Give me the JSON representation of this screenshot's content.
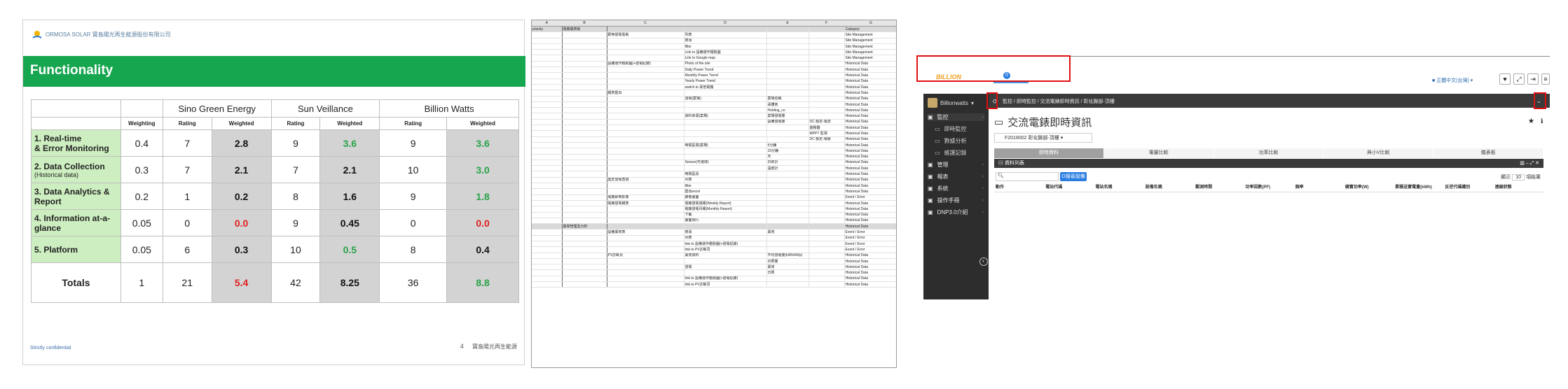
{
  "slide": {
    "logo_text": "ORMOSA SOLAR 寶島陽光再生能源股份有限公司",
    "logo_caption": "FORMOSA",
    "title": "Functionality",
    "vendors": [
      "Sino Green Energy",
      "Sun Veillance",
      "Billion Watts"
    ],
    "subheaders": {
      "weighting": "Weighting",
      "rating": "Rating",
      "weighted": "Weighted"
    },
    "rows": [
      {
        "criterion": "1. Real-time\n& Error Monitoring",
        "sub": "",
        "weight": "0.4",
        "v": [
          "7",
          "2.8",
          "9",
          "3.6",
          "9",
          "3.6"
        ]
      },
      {
        "criterion": "2. Data Collection",
        "sub": "(Historical data)",
        "weight": "0.3",
        "v": [
          "7",
          "2.1",
          "7",
          "2.1",
          "10",
          "3.0"
        ]
      },
      {
        "criterion": "3. Data Analytics & Report",
        "sub": "",
        "weight": "0.2",
        "v": [
          "1",
          "0.2",
          "8",
          "1.6",
          "9",
          "1.8"
        ]
      },
      {
        "criterion": "4. Information at-a-glance",
        "sub": "",
        "weight": "0.05",
        "v": [
          "0",
          "0.0",
          "9",
          "0.45",
          "0",
          "0.0"
        ]
      },
      {
        "criterion": "5. Platform",
        "sub": "",
        "weight": "0.05",
        "v": [
          "6",
          "0.3",
          "10",
          "0.5",
          "8",
          "0.4"
        ]
      }
    ],
    "weighted_colors": [
      [
        "black",
        "green",
        "green"
      ],
      [
        "black",
        "black",
        "green"
      ],
      [
        "black",
        "black",
        "green"
      ],
      [
        "red",
        "black",
        "red"
      ],
      [
        "black",
        "green",
        "black"
      ]
    ],
    "totals": {
      "label": "Totals",
      "weight": "1",
      "v": [
        "21",
        "5.4",
        "42",
        "8.25",
        "36",
        "8.8"
      ],
      "colors": [
        "red",
        "black",
        "green"
      ]
    },
    "footer_left": "Strictly confidential",
    "page_number": "4",
    "footer_right": "寶島陽光再生能源",
    "colors": {
      "banner": "#17a650",
      "criterion_bg": "#cdeec0",
      "weighted_bg": "#d3d3d3",
      "green": "#29a34a",
      "red": "#e02020"
    }
  },
  "sheet": {
    "col_headers": [
      "A",
      "B",
      "C",
      "D",
      "E",
      "F",
      "G"
    ],
    "rows": [
      [
        "priority",
        "電廠儀表板",
        "",
        "",
        "",
        "",
        "Category"
      ],
      [
        "",
        "",
        "即時發電看板",
        "列表",
        "",
        "",
        "Site Management"
      ],
      [
        "",
        "",
        "",
        "搜尋",
        "",
        "",
        "Site Management"
      ],
      [
        "",
        "",
        "",
        "filter",
        "",
        "",
        "Site Management"
      ],
      [
        "",
        "",
        "",
        "Link to 設備運作趨勢圖",
        "",
        "",
        "Site Management"
      ],
      [
        "",
        "",
        "",
        "Link to Google map",
        "",
        "",
        "Site Management"
      ],
      [
        "",
        "",
        "設備運作趨勢圖(+發電紀錄)",
        "Photo of the site",
        "",
        "",
        "Historical Data"
      ],
      [
        "",
        "",
        "",
        "Daily Power Trend",
        "",
        "",
        "Historical Data"
      ],
      [
        "",
        "",
        "",
        "Monthly Power Trend",
        "",
        "",
        "Historical Data"
      ],
      [
        "",
        "",
        "",
        "Yearly Power Trend",
        "",
        "",
        "Historical Data"
      ],
      [
        "",
        "",
        "",
        "switch to 其他電廠",
        "",
        "",
        "Historical Data"
      ],
      [
        "",
        "",
        "報表匯出",
        "",
        "",
        "",
        "Historical Data"
      ],
      [
        "",
        "",
        "",
        "發電(案場)",
        "案場名稱",
        "",
        "Historical Data"
      ],
      [
        "",
        "",
        "",
        "",
        "承攬商",
        "",
        "Historical Data"
      ],
      [
        "",
        "",
        "",
        "",
        "Holding_co",
        "",
        "Historical Data"
      ],
      [
        "",
        "",
        "",
        "資料來源(案場)",
        "案場發電量",
        "",
        "Historical Data"
      ],
      [
        "",
        "",
        "",
        "",
        "設備發電量",
        "DC 額定-電流",
        "Historical Data"
      ],
      [
        "",
        "",
        "",
        "",
        "",
        "變壓器",
        "Historical Data"
      ],
      [
        "",
        "",
        "",
        "",
        "",
        "MPPT 監視",
        "Historical Data"
      ],
      [
        "",
        "",
        "",
        "",
        "",
        "DC 額定-電壓",
        "Historical Data"
      ],
      [
        "",
        "",
        "",
        "時間區間(案場)",
        "5分鐘",
        "",
        "Historical Data"
      ],
      [
        "",
        "",
        "",
        "",
        "15分鐘",
        "",
        "Historical Data"
      ],
      [
        "",
        "",
        "",
        "",
        "天",
        "",
        "Historical Data"
      ],
      [
        "",
        "",
        "",
        "Sensor(可選擇)",
        "日照計",
        "",
        "Historical Data"
      ],
      [
        "",
        "",
        "",
        "",
        "溫度計",
        "",
        "Historical Data"
      ],
      [
        "",
        "",
        "",
        "時間區段",
        "",
        "",
        "Historical Data"
      ],
      [
        "",
        "",
        "歷史發電查詢",
        "列表",
        "",
        "",
        "Historical Data"
      ],
      [
        "",
        "",
        "",
        "filter",
        "",
        "",
        "Historical Data"
      ],
      [
        "",
        "",
        "",
        "匯出excel",
        "",
        "",
        "Historical Data"
      ],
      [
        "",
        "",
        "電廠即時影像",
        "錄像畫面",
        "",
        "",
        "Event / Error"
      ],
      [
        "",
        "",
        "電廠發電報表",
        "電廠發電週報(Weekly Report)",
        "",
        "",
        "Historical Data"
      ],
      [
        "",
        "",
        "",
        "電廠發電月報(Monthly Report)",
        "",
        "",
        "Historical Data"
      ],
      [
        "",
        "",
        "",
        "下載",
        "",
        "",
        "Historical Data"
      ],
      [
        "",
        "",
        "",
        "畫面預行",
        "",
        "",
        "Historical Data"
      ],
      [
        "",
        "異常管理及分析",
        "",
        "",
        "",
        "",
        "Historical Data"
      ],
      [
        "",
        "",
        "設備異常表",
        "搜尋",
        "異常",
        "",
        "Event / Error"
      ],
      [
        "",
        "",
        "",
        "列表",
        "",
        "",
        "Event / Error"
      ],
      [
        "",
        "",
        "",
        "link to 設備運作趨勢圖(+發電紀錄)",
        "",
        "",
        "Event / Error"
      ],
      [
        "",
        "",
        "",
        "link to PV診斷頁",
        "",
        "",
        "Event / Error"
      ],
      [
        "",
        "",
        "PV診斷頁",
        "異常資料",
        "平均發電量(kWh/kWp)",
        "",
        "Historical Data"
      ],
      [
        "",
        "",
        "",
        "",
        "日照量",
        "",
        "Historical Data"
      ],
      [
        "",
        "",
        "",
        "發電",
        "異常",
        "",
        "Historical Data"
      ],
      [
        "",
        "",
        "",
        "",
        "日照",
        "",
        "Historical Data"
      ],
      [
        "",
        "",
        "",
        "link to 設備運作趨勢圖(+發電紀錄)",
        "",
        "",
        "Historical Data"
      ],
      [
        "",
        "",
        "",
        "link to PV診斷頁",
        "",
        "",
        "Historical Data"
      ]
    ]
  },
  "app": {
    "brand": "BILLION",
    "tab_badge": "0",
    "language": "正體中文(台灣)",
    "username": "Billionwatts",
    "sidebar": [
      {
        "label": "監控",
        "icon": "monitor-icon",
        "level": 0,
        "selected": true
      },
      {
        "label": "即時監控",
        "icon": "screen-icon",
        "level": 1
      },
      {
        "label": "數據分析",
        "icon": "chart-icon",
        "level": 1
      },
      {
        "label": "維護記錄",
        "icon": "record-icon",
        "level": 1
      },
      {
        "label": "管理",
        "icon": "manage-icon",
        "level": 0
      },
      {
        "label": "報表",
        "icon": "report-icon",
        "level": 0
      },
      {
        "label": "系統",
        "icon": "gear-icon",
        "level": 0
      },
      {
        "label": "操作手冊",
        "icon": "manual-icon",
        "level": 0
      },
      {
        "label": "DNP3.0介紹",
        "icon": "doc-icon",
        "level": 0
      }
    ],
    "breadcrumb": [
      "監控",
      "即時監控",
      "交流電錶即時資訊",
      "彰化縣部-頂樓"
    ],
    "page_title": "交流電錶即時資訊",
    "device_select": "F2018002 彰化縣部-頂樓",
    "tabs": [
      "即時資料",
      "電量比較",
      "功率比較",
      "與小V比較",
      "儀表板"
    ],
    "list_title": "資料列表",
    "search_button": "O搜尋設備",
    "show_label": "顯示",
    "show_value": "10",
    "show_suffix": "項結果",
    "columns": [
      "動作",
      "電站代碼",
      "電站名稱",
      "設備名稱",
      "觀測時間",
      "功率因數(PF)",
      "頻率",
      "總實功率(W)",
      "累積送實電量(kWh)",
      "反逆代碼識別",
      "連線狀態"
    ],
    "colors": {
      "highlight_box": "#e01010",
      "sidebar_bg": "#2d2d2d",
      "search_button": "#2a7de1"
    }
  }
}
